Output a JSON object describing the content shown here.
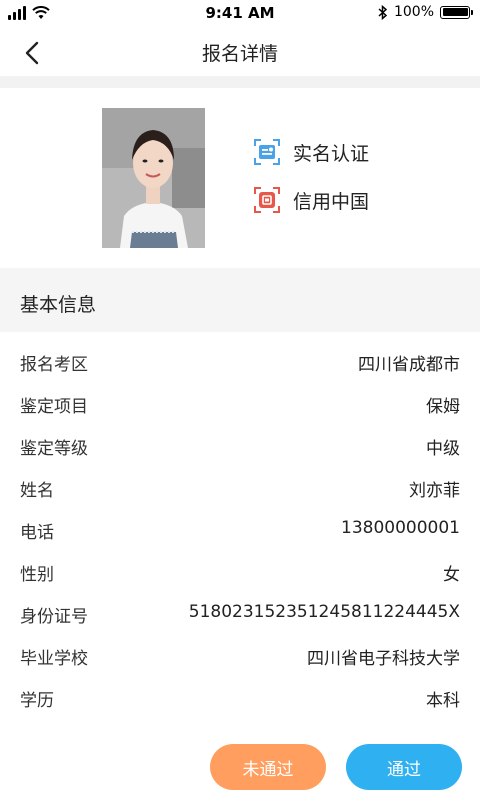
{
  "status_bar": {
    "time": "9:41 AM",
    "battery_text": "100%",
    "battery_level": 1.0,
    "icons": [
      "signal-icon",
      "wifi-icon",
      "bluetooth-icon",
      "battery-icon"
    ]
  },
  "nav": {
    "title": "报名详情",
    "back_icon": "chevron-left-icon"
  },
  "profile": {
    "verifications": [
      {
        "label": "实名认证",
        "icon": "id-scan-icon",
        "color": "#4aa3e8"
      },
      {
        "label": "信用中国",
        "icon": "credit-scan-icon",
        "color": "#e8584a"
      }
    ]
  },
  "section": {
    "title": "基本信息"
  },
  "info": [
    {
      "label": "报名考区",
      "value": "四川省成都市"
    },
    {
      "label": "鉴定项目",
      "value": "保姆"
    },
    {
      "label": "鉴定等级",
      "value": "中级"
    },
    {
      "label": "姓名",
      "value": "刘亦菲"
    },
    {
      "label": "电话",
      "value": "13800000001"
    },
    {
      "label": "性别",
      "value": "女"
    },
    {
      "label": "身份证号",
      "value": "518023152351245811224445X"
    },
    {
      "label": "毕业学校",
      "value": "四川省电子科技大学"
    },
    {
      "label": "学历",
      "value": "本科"
    }
  ],
  "actions": {
    "reject_label": "未通过",
    "approve_label": "通过",
    "reject_color": "#ff9e5e",
    "approve_color": "#2fb0f0"
  }
}
